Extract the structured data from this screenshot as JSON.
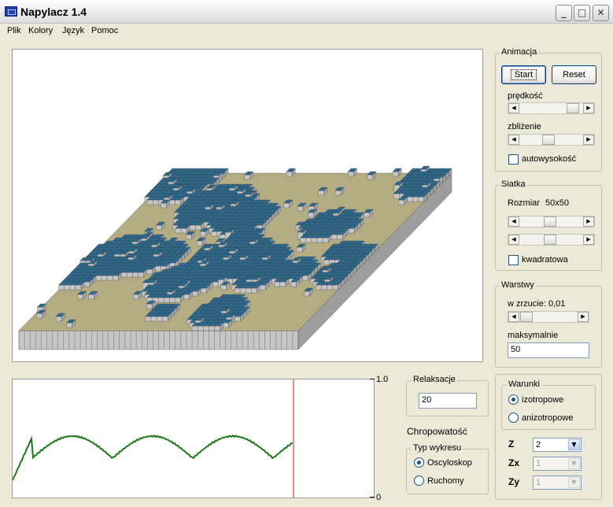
{
  "window": {
    "title": "Napylacz 1.4",
    "minimize_icon": "minimize-icon",
    "maximize_icon": "maximize-icon",
    "close_icon": "close-icon"
  },
  "menu": [
    {
      "label": "Plik"
    },
    {
      "label": "Kolory"
    },
    {
      "label": "Język"
    },
    {
      "label": "Pomoc"
    }
  ],
  "animation": {
    "group_label": "Animacja",
    "start_label": "Start",
    "reset_label": "Reset",
    "speed_label": "prędkość",
    "speed_value": 0.93,
    "zoom_label": "zbliżenie",
    "zoom_value": 0.45,
    "auto_height_label": "autowysokość",
    "auto_height_checked": false
  },
  "grid": {
    "group_label": "Siatka",
    "size_label": "Rozmiar",
    "size_value": "50x50",
    "slider1_value": 0.47,
    "slider2_value": 0.47,
    "square_label": "kwadratowa",
    "square_checked": false
  },
  "layers": {
    "group_label": "Warstwy",
    "drop_label": "w zrzucie: 0,01",
    "drop_value": 0.02,
    "max_label": "maksymalnie",
    "max_value": "50"
  },
  "relax": {
    "group_label": "Relaksacje",
    "value": "20"
  },
  "roughness": {
    "title": "Chropowatość",
    "plot_type_label": "Typ wykresu",
    "options": [
      {
        "label": "Oscyloskop",
        "selected": true
      },
      {
        "label": "Ruchomy",
        "selected": false
      }
    ],
    "y_top_label": "1.0",
    "y_bottom_label": "0"
  },
  "conditions": {
    "group_label": "Warunki",
    "options": [
      {
        "label": "izotropowe",
        "selected": true
      },
      {
        "label": "anizotropowe",
        "selected": false
      }
    ],
    "z_label": "Z",
    "z_value": "2",
    "zx_label": "Zx",
    "zx_value": "1",
    "zy_label": "Zy",
    "zy_value": "1"
  },
  "colors": {
    "top": "#2e6a8e",
    "substrate": "#b4ac82",
    "side": "#c6c6c6",
    "line": "#1a7a1a",
    "cursor": "#cc1a1a"
  }
}
